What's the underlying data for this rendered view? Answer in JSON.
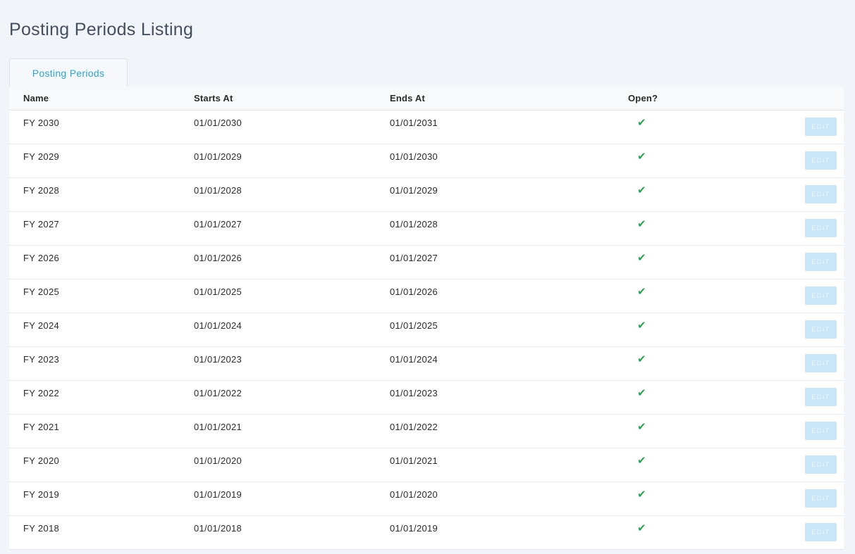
{
  "page": {
    "title": "Posting Periods Listing"
  },
  "tabs": [
    {
      "label": "Posting Periods"
    }
  ],
  "table": {
    "headers": {
      "name": "Name",
      "starts_at": "Starts At",
      "ends_at": "Ends At",
      "open": "Open?"
    },
    "edit_label": "EDIT",
    "open_glyph": "✔",
    "rows": [
      {
        "name": "FY 2030",
        "starts_at": "01/01/2030",
        "ends_at": "01/01/2031",
        "open": true
      },
      {
        "name": "FY 2029",
        "starts_at": "01/01/2029",
        "ends_at": "01/01/2030",
        "open": true
      },
      {
        "name": "FY 2028",
        "starts_at": "01/01/2028",
        "ends_at": "01/01/2029",
        "open": true
      },
      {
        "name": "FY 2027",
        "starts_at": "01/01/2027",
        "ends_at": "01/01/2028",
        "open": true
      },
      {
        "name": "FY 2026",
        "starts_at": "01/01/2026",
        "ends_at": "01/01/2027",
        "open": true
      },
      {
        "name": "FY 2025",
        "starts_at": "01/01/2025",
        "ends_at": "01/01/2026",
        "open": true
      },
      {
        "name": "FY 2024",
        "starts_at": "01/01/2024",
        "ends_at": "01/01/2025",
        "open": true
      },
      {
        "name": "FY 2023",
        "starts_at": "01/01/2023",
        "ends_at": "01/01/2024",
        "open": true
      },
      {
        "name": "FY 2022",
        "starts_at": "01/01/2022",
        "ends_at": "01/01/2023",
        "open": true
      },
      {
        "name": "FY 2021",
        "starts_at": "01/01/2021",
        "ends_at": "01/01/2022",
        "open": true
      },
      {
        "name": "FY 2020",
        "starts_at": "01/01/2020",
        "ends_at": "01/01/2021",
        "open": true
      },
      {
        "name": "FY 2019",
        "starts_at": "01/01/2019",
        "ends_at": "01/01/2020",
        "open": true
      },
      {
        "name": "FY 2018",
        "starts_at": "01/01/2018",
        "ends_at": "01/01/2019",
        "open": true
      }
    ]
  },
  "colors": {
    "background": "#f1f4f8",
    "accent": "#2aa6d8",
    "check": "#2da44e",
    "edit_button_bg": "#c9e6f6"
  },
  "icons": {
    "open": "checkmark-icon"
  }
}
